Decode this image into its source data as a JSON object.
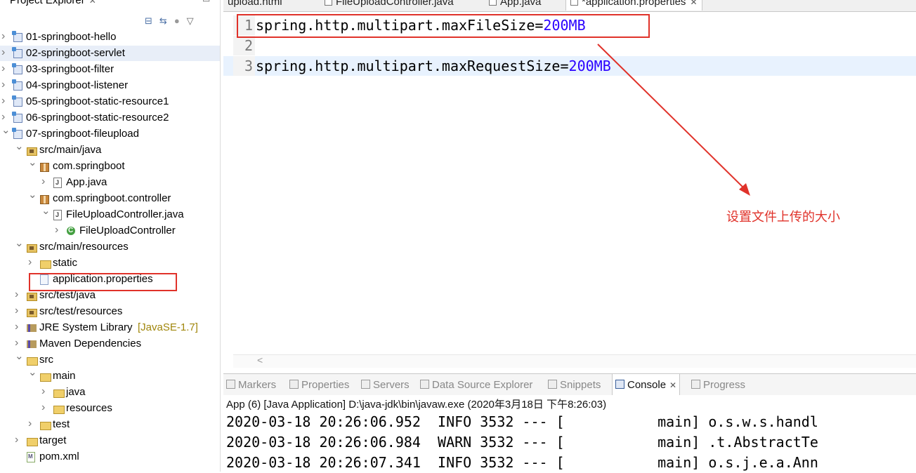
{
  "project_explorer": {
    "title": "Project Explorer",
    "items": [
      {
        "label": "01-springboot-hello",
        "icon": "project-icon"
      },
      {
        "label": "02-springboot-servlet",
        "icon": "project-icon"
      },
      {
        "label": "03-springboot-filter",
        "icon": "project-icon"
      },
      {
        "label": "04-springboot-listener",
        "icon": "project-icon"
      },
      {
        "label": "05-springboot-static-resource1",
        "icon": "project-icon"
      },
      {
        "label": "06-springboot-static-resource2",
        "icon": "project-icon"
      },
      {
        "label": "07-springboot-fileupload",
        "icon": "project-icon"
      },
      {
        "label": "src/main/java",
        "icon": "source-folder-icon"
      },
      {
        "label": "com.springboot",
        "icon": "package-icon"
      },
      {
        "label": "App.java",
        "icon": "java-file-icon"
      },
      {
        "label": "com.springboot.controller",
        "icon": "package-icon"
      },
      {
        "label": "FileUploadController.java",
        "icon": "java-file-icon"
      },
      {
        "label": "FileUploadController",
        "icon": "class-icon"
      },
      {
        "label": "src/main/resources",
        "icon": "source-folder-icon"
      },
      {
        "label": "static",
        "icon": "folder-icon"
      },
      {
        "label": "application.properties",
        "icon": "file-icon"
      },
      {
        "label": "src/test/java",
        "icon": "source-folder-icon"
      },
      {
        "label": "src/test/resources",
        "icon": "source-folder-icon"
      },
      {
        "label": "JRE System Library",
        "decoration": "[JavaSE-1.7]",
        "icon": "library-icon"
      },
      {
        "label": "Maven Dependencies",
        "icon": "library-icon"
      },
      {
        "label": "src",
        "icon": "folder-icon"
      },
      {
        "label": "main",
        "icon": "folder-icon"
      },
      {
        "label": "java",
        "icon": "folder-icon"
      },
      {
        "label": "resources",
        "icon": "folder-icon"
      },
      {
        "label": "test",
        "icon": "folder-icon"
      },
      {
        "label": "target",
        "icon": "folder-icon"
      },
      {
        "label": "pom.xml",
        "icon": "xml-file-icon"
      }
    ]
  },
  "editor": {
    "tabs": [
      {
        "label": "upload.html"
      },
      {
        "label": "FileUploadController.java"
      },
      {
        "label": "App.java"
      },
      {
        "label": "*application.properties",
        "active": true
      }
    ],
    "lines": [
      {
        "number": "1",
        "key": "spring.http.multipart.maxFileSize=",
        "value": "200MB"
      },
      {
        "number": "2",
        "key": "",
        "value": ""
      },
      {
        "number": "3",
        "key": "spring.http.multipart.maxRequestSize=",
        "value": "200MB"
      }
    ],
    "scroll_arrow": "<"
  },
  "annotation": {
    "text": "设置文件上传的大小",
    "color": "#e0322a"
  },
  "console_view": {
    "tabs": [
      {
        "label": "Markers",
        "icon": "markers-icon"
      },
      {
        "label": "Properties",
        "icon": "properties-icon"
      },
      {
        "label": "Servers",
        "icon": "servers-icon"
      },
      {
        "label": "Data Source Explorer",
        "icon": "data-source-icon"
      },
      {
        "label": "Snippets",
        "icon": "snippets-icon"
      },
      {
        "label": "Console",
        "icon": "console-icon",
        "active": true
      },
      {
        "label": "Progress",
        "icon": "progress-icon"
      }
    ],
    "description": "App (6) [Java Application] D:\\java-jdk\\bin\\javaw.exe (2020年3月18日 下午8:26:03)",
    "log_lines": [
      "2020-03-18 20:26:06.952  INFO 3532 --- [           main] o.s.w.s.handl",
      "2020-03-18 20:26:06.984  WARN 3532 --- [           main] .t.AbstractTe",
      "2020-03-18 20:26:07.341  INFO 3532 --- [           main] o.s.j.e.a.Ann"
    ]
  }
}
